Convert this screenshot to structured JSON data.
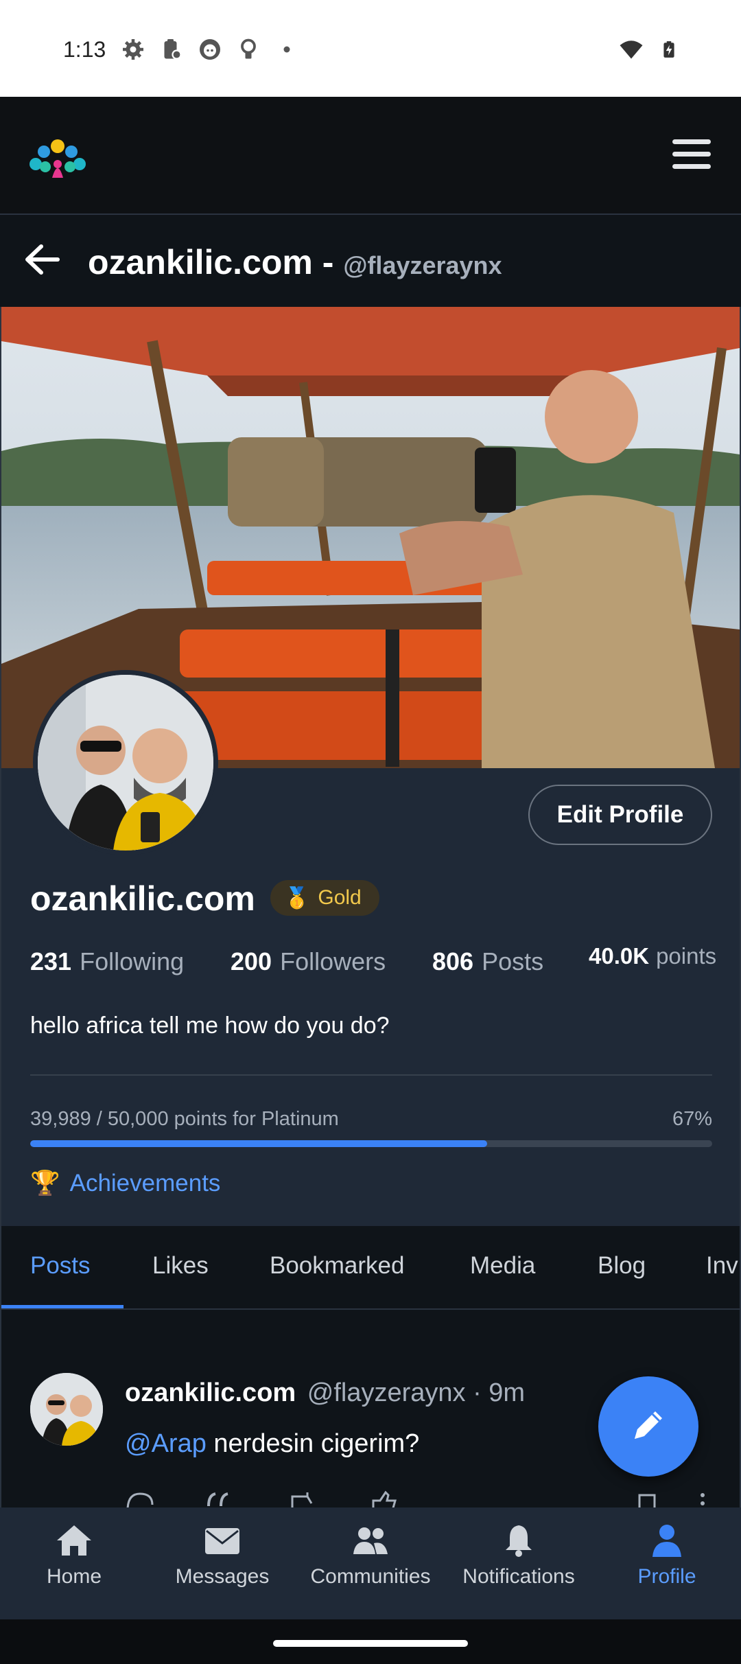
{
  "status_bar": {
    "time": "1:13"
  },
  "header": {
    "title": "ozankilic.com -",
    "handle": "@flayzeraynx"
  },
  "profile": {
    "edit_label": "Edit Profile",
    "display_name": "ozankilic.com",
    "badge": "Gold",
    "stats": [
      {
        "num": "231",
        "label": "Following"
      },
      {
        "num": "200",
        "label": "Followers"
      },
      {
        "num": "806",
        "label": "Posts"
      },
      {
        "num": "40.0K",
        "label": "points"
      }
    ],
    "bio": "hello africa tell me how do you do?",
    "progress_label": "39,989 / 50,000 points for Platinum",
    "progress_pct": "67%",
    "progress_fraction": 0.67,
    "achievements": "Achievements"
  },
  "tabs": [
    "Posts",
    "Likes",
    "Bookmarked",
    "Media",
    "Blog",
    "Inv"
  ],
  "post": {
    "author": "ozankilic.com",
    "meta": "@flayzeraynx · 9m",
    "mention": "@Arap",
    "text": " nerdesin cigerim?"
  },
  "nav": [
    "Home",
    "Messages",
    "Communities",
    "Notifications",
    "Profile"
  ],
  "colors": {
    "accent": "#3b82f6",
    "surface": "#1f2937",
    "background": "#0f1419",
    "gold": "#f2c94c"
  }
}
